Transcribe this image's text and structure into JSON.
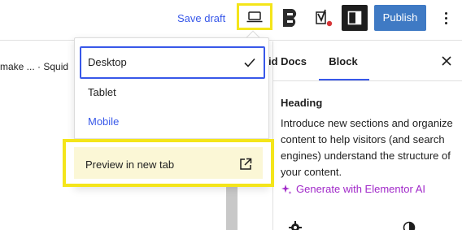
{
  "toolbar": {
    "save_draft": "Save draft",
    "publish": "Publish",
    "preview_icon": "laptop-icon",
    "brand_icon": "elementor-b-icon",
    "yoast_icon": "yoast-icon",
    "sidebar_icon": "sidebar-toggle-icon",
    "more_icon": "more-vertical-icon",
    "highlight_color": "#f4e51a",
    "publish_color": "#3f7ac4"
  },
  "editor": {
    "breadcrumb": "make ... · Squid"
  },
  "preview_menu": {
    "options": [
      {
        "label": "Desktop",
        "selected": true
      },
      {
        "label": "Tablet",
        "selected": false
      },
      {
        "label": "Mobile",
        "selected": false
      }
    ],
    "preview_new_tab": "Preview in new tab",
    "external_icon": "external-link-icon"
  },
  "sidebar": {
    "tabs": [
      {
        "label": "id Docs",
        "active": false
      },
      {
        "label": "Block",
        "active": true
      }
    ],
    "block_title": "Heading",
    "block_description": "Introduce new sections and organize content to help visitors (and search engines) understand the structure of your content.",
    "generate_ai": "Generate with Elementor AI",
    "ai_color": "#a129c9",
    "accent_color": "#3858e9"
  }
}
